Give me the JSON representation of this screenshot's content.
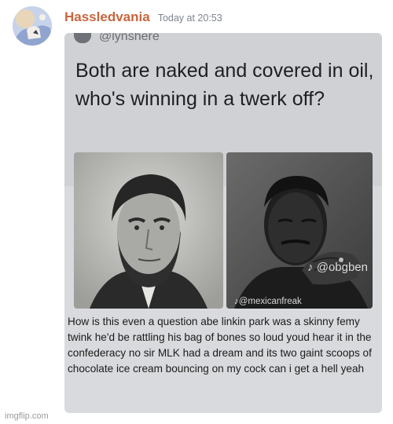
{
  "message": {
    "username": "Hassledvania",
    "timestamp": "Today at 20:53",
    "avatar_icon": "avatar-icon"
  },
  "attachment": {
    "tweet_handle": "@lynshere",
    "tweet_text": "Both are naked and covered in oil, who's winning in a twerk off?",
    "left_photo_icon": "portrait-icon",
    "right_photo_icon": "portrait-icon",
    "watermark_1": "♪ @obgben",
    "watermark_2": "♪@mexicanfreak",
    "caption": "How is this even a question abe linkin park was a skinny femy twink he'd be rattling his bag of bones so loud youd hear it in the confederacy no sir MLK had a dream and its two gaint scoops of chocolate ice cream bouncing on my cock can i get a hell yeah"
  },
  "footer": {
    "site": "imgflip.com"
  },
  "colors": {
    "username": "#c8663e",
    "timestamp": "#7d8490",
    "tweet_bg": "#cfd1d4",
    "text": "#1b1b1b"
  }
}
